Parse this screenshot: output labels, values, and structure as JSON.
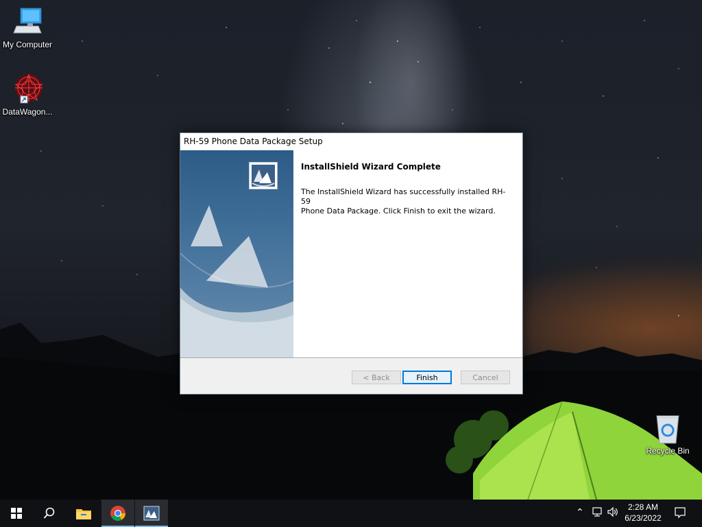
{
  "desktop": {
    "icons": [
      {
        "label": "My Computer"
      },
      {
        "label": "DataWagon..."
      },
      {
        "label": "Recycle Bin"
      }
    ]
  },
  "dialog": {
    "title": "RH-59 Phone Data Package Setup",
    "heading": "InstallShield Wizard Complete",
    "message": "The InstallShield Wizard has successfully installed RH-59\nPhone Data Package.  Click Finish to exit the wizard.",
    "buttons": {
      "back": "< Back",
      "finish": "Finish",
      "cancel": "Cancel"
    }
  },
  "taskbar": {
    "items": [
      {
        "icon": "windows-start-icon"
      },
      {
        "icon": "search-icon"
      },
      {
        "icon": "file-explorer-icon"
      },
      {
        "icon": "chrome-icon"
      },
      {
        "icon": "installshield-icon"
      }
    ],
    "clock": {
      "time": "2:28 AM",
      "date": "6/23/2022"
    }
  },
  "colors": {
    "accent": "#0078d7",
    "taskbar": "#101114",
    "tent_green": "#8fd43a"
  }
}
